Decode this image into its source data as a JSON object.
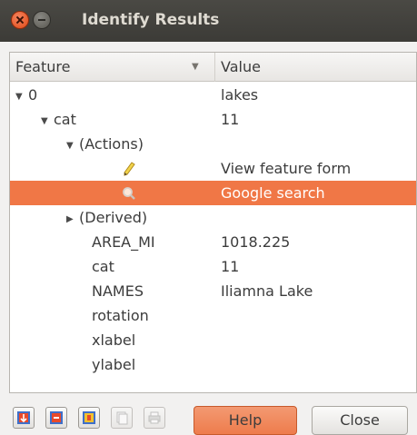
{
  "window": {
    "title": "Identify Results"
  },
  "header": {
    "feature": "Feature",
    "value": "Value"
  },
  "rows": [
    {
      "key": "0",
      "value": "lakes"
    },
    {
      "key": "cat",
      "value": "11"
    },
    {
      "key": "(Actions)",
      "value": ""
    },
    {
      "key": "",
      "value": "View feature form",
      "icon": "pencil-icon"
    },
    {
      "key": "",
      "value": "Google search",
      "icon": "search-icon"
    },
    {
      "key": "(Derived)",
      "value": ""
    },
    {
      "key": "AREA_MI",
      "value": "1018.225"
    },
    {
      "key": "cat",
      "value": "11"
    },
    {
      "key": "NAMES",
      "value": "Iliamna Lake"
    },
    {
      "key": "rotation",
      "value": ""
    },
    {
      "key": "xlabel",
      "value": ""
    },
    {
      "key": "ylabel",
      "value": ""
    }
  ],
  "footer": {
    "tools": [
      "expand-icon",
      "collapse-icon",
      "expand-new-icon",
      "copy-icon",
      "print-icon"
    ],
    "help_label": "Help",
    "close_label": "Close"
  },
  "colors": {
    "selection": "#f07746",
    "titlebar": "#3c3b37",
    "help_button": "#ee7c4c"
  }
}
